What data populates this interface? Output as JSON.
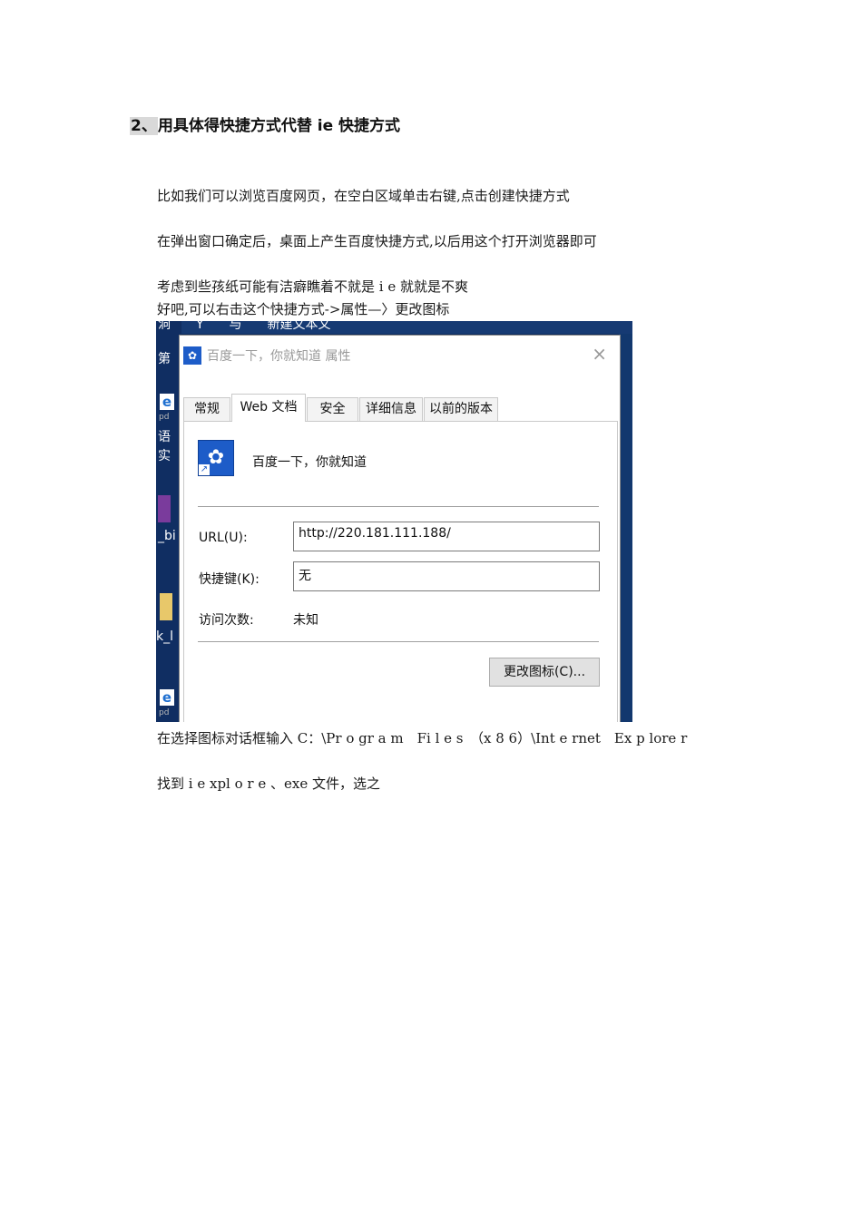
{
  "doc": {
    "heading_num": "2、",
    "heading_text": "用具体得快捷方式代替 ie 快捷方式",
    "p1": "比如我们可以浏览百度网页，在空白区域单击右键,点击创建快捷方式",
    "p2": "在弹出窗口确定后，桌面上产生百度快捷方式,以后用这个打开浏览器即可",
    "p3": "考虑到些孩纸可能有洁癖瞧着不就是 i e 就就是不爽",
    "p4": "好吧,可以右击这个快捷方式->属性—〉更改图标",
    "p5": "在选择图标对话框输入 C：\\Pr o gr a m　Fi l e s　（x 8 6）\\Int e rnet　Ex p lore r",
    "p6": "找到 i e xpl o r e 、exe 文件，选之"
  },
  "desktop": {
    "top_text": "洞　　Y　　与　　新建文本文",
    "left_labels": [
      "第",
      "语",
      "实",
      "_bi",
      "k_l"
    ],
    "icon_letter": "e",
    "icon_sub": "pd"
  },
  "dialog": {
    "title": "百度一下，你就知道 属性",
    "close": "×",
    "tabs": [
      "常规",
      "Web 文档",
      "安全",
      "详细信息",
      "以前的版本"
    ],
    "site_name": "百度一下，你就知道",
    "url_label": "URL(U):",
    "url_value": "http://220.181.111.188/",
    "hotkey_label": "快捷键(K):",
    "hotkey_value": "无",
    "visits_label": "访问次数:",
    "visits_value": "未知",
    "change_icon_button": "更改图标(C)..."
  },
  "icons": {
    "paw": "paw-icon",
    "shortcut": "shortcut-arrow-icon",
    "close": "close-icon",
    "ie": "ie-icon"
  },
  "colors": {
    "desktop": "#0d2a5c",
    "baidu_blue": "#1d5cc8"
  }
}
